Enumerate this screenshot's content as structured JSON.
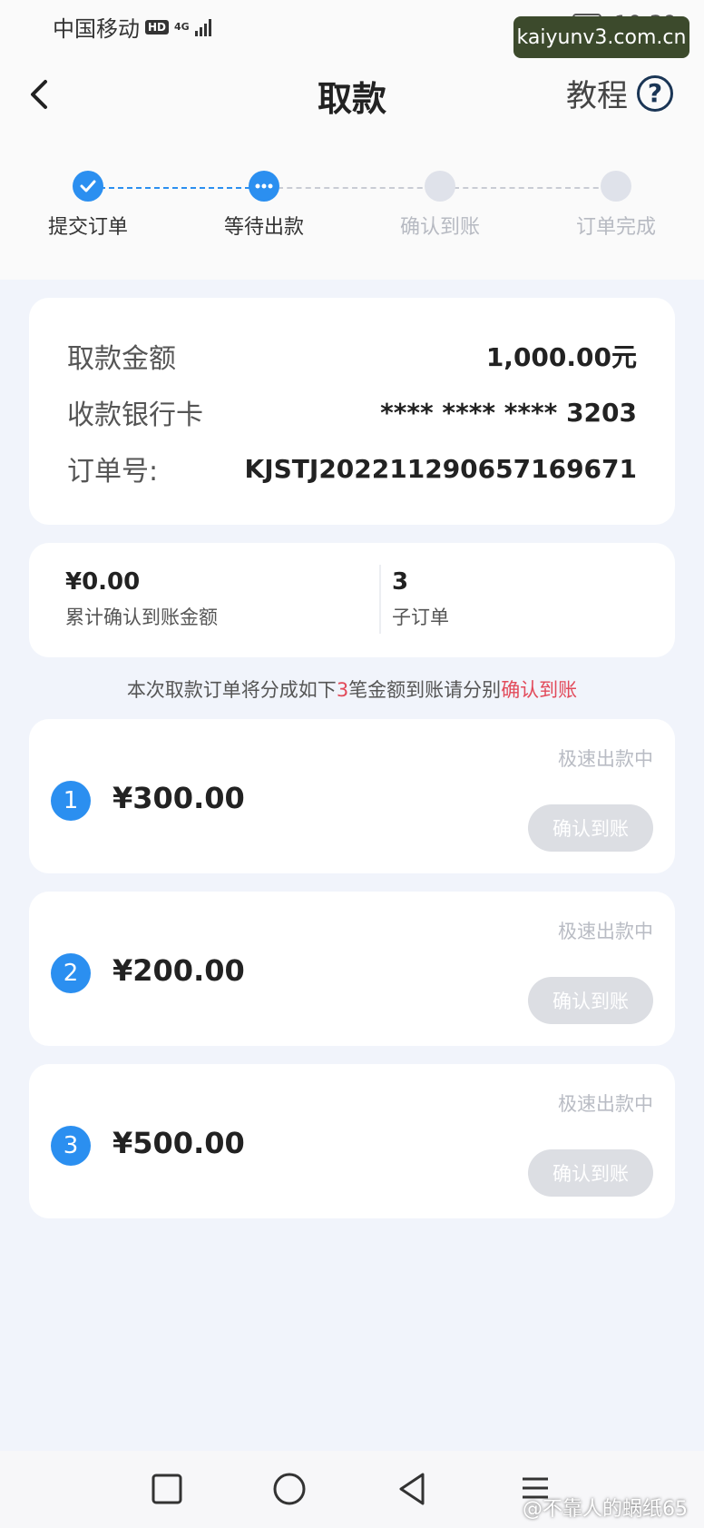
{
  "status_bar": {
    "carrier": "中国移动",
    "hd": "HD",
    "network": "4G",
    "time": "10:39"
  },
  "watermark_top": "kaiyunv3.com.cn",
  "header": {
    "title": "取款",
    "tutorial_label": "教程",
    "help_glyph": "?"
  },
  "steps": [
    {
      "label": "提交订单",
      "state": "done"
    },
    {
      "label": "等待出款",
      "state": "current"
    },
    {
      "label": "确认到账",
      "state": "pending"
    },
    {
      "label": "订单完成",
      "state": "pending"
    }
  ],
  "order_info": {
    "amount_label": "取款金额",
    "amount_value": "1,000.00元",
    "card_label": "收款银行卡",
    "card_value": "**** **** **** 3203",
    "order_no_label": "订单号:",
    "order_no_value": "KJSTJ20221129065716967​1"
  },
  "summary": {
    "confirmed_amount": "¥0.00",
    "confirmed_label": "累计确认到账金额",
    "sub_order_count": "3",
    "sub_order_label": "子订单"
  },
  "notice": {
    "prefix": "本次取款订单将分成如下",
    "count": "3",
    "middle": "笔金额到账请分别",
    "action": "确认到账"
  },
  "sub_orders": [
    {
      "index": "1",
      "amount": "¥300.00",
      "status": "极速出款中",
      "button": "确认到账"
    },
    {
      "index": "2",
      "amount": "¥200.00",
      "status": "极速出款中",
      "button": "确认到账"
    },
    {
      "index": "3",
      "amount": "¥500.00",
      "status": "极速出款中",
      "button": "确认到账"
    }
  ],
  "watermark_bottom": "@不靠人的蜗纸65",
  "colors": {
    "accent": "#2b8ff0",
    "highlight_red": "#e24a5a",
    "disabled_button": "#dcdee3"
  }
}
